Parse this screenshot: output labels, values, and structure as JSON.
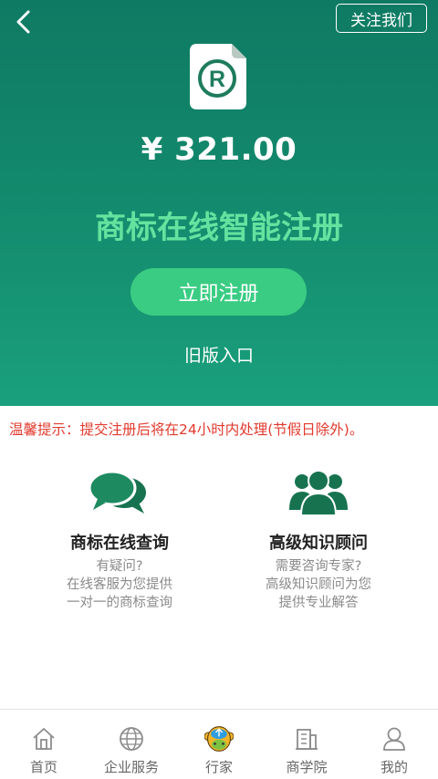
{
  "header": {
    "back_icon": "chevron-left-icon",
    "follow_label": "关注我们"
  },
  "hero": {
    "icon": "registered-trademark-document-icon",
    "price": "¥ 321.00",
    "title": "商标在线智能注册",
    "register_label": "立即注册",
    "old_version_label": "旧版入口"
  },
  "notice": "温馨提示：提交注册后将在24小时内处理(节假日除外)。",
  "features": [
    {
      "icon": "chat-bubbles-icon",
      "title": "商标在线查询",
      "lines": [
        "有疑问?",
        "在线客服为您提供",
        "一对一的商标查询"
      ]
    },
    {
      "icon": "people-group-icon",
      "title": "高级知识顾问",
      "lines": [
        "需要咨询专家?",
        "高级知识顾问为您",
        "提供专业解答"
      ]
    }
  ],
  "tabbar": {
    "items": [
      {
        "label": "首页",
        "icon": "home-icon"
      },
      {
        "label": "企业服务",
        "icon": "globe-icon"
      },
      {
        "label": "行家",
        "icon": "monkey-mascot-icon"
      },
      {
        "label": "商学院",
        "icon": "building-icon"
      },
      {
        "label": "我的",
        "icon": "user-icon"
      }
    ]
  },
  "colors": {
    "hero_top": "#0f7a63",
    "hero_bottom": "#1aa07c",
    "title_green": "#63e39f",
    "button_green": "#3bcc83",
    "icon_green": "#17734f",
    "notice_red": "#e23a2e"
  }
}
